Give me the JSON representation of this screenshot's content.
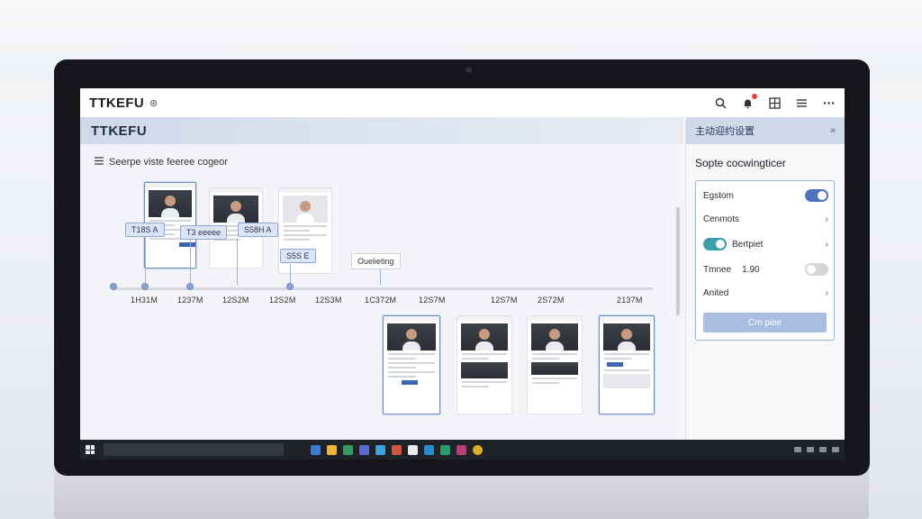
{
  "window": {
    "app_name": "TTKEFU",
    "app_badge": "⊛"
  },
  "header": {
    "title": "TTKEFU"
  },
  "main": {
    "title": "Seerpe viste feeree cogeor",
    "chips": [
      "T18S  A",
      "T3 eeeee",
      "S58H A",
      "S5S E"
    ],
    "plain_label": "Ouelieting",
    "times": [
      "1H31M",
      "1237M",
      "12S2M",
      "12S2M",
      "12S3M",
      "1C372M",
      "12S7M",
      "12S7M",
      "2S72M",
      "2137M"
    ]
  },
  "panel": {
    "head": "主动迎约设置",
    "close": "»",
    "title": "Sopte cocwingticer",
    "rows": {
      "r1": "Egstom",
      "r2": "Cenmots",
      "r3": "Bertpiet",
      "r4_label": "Tmnee",
      "r4_value": "1.90",
      "r5": "Anited"
    },
    "apply": "Cm piee"
  },
  "colors": {
    "accent": "#4e74c0",
    "header_band": "#cfd9ea",
    "teal_toggle": "#3aa0a8"
  },
  "icons": [
    "search-icon",
    "bell-icon",
    "grid-icon",
    "menu-icon",
    "more-icon"
  ]
}
